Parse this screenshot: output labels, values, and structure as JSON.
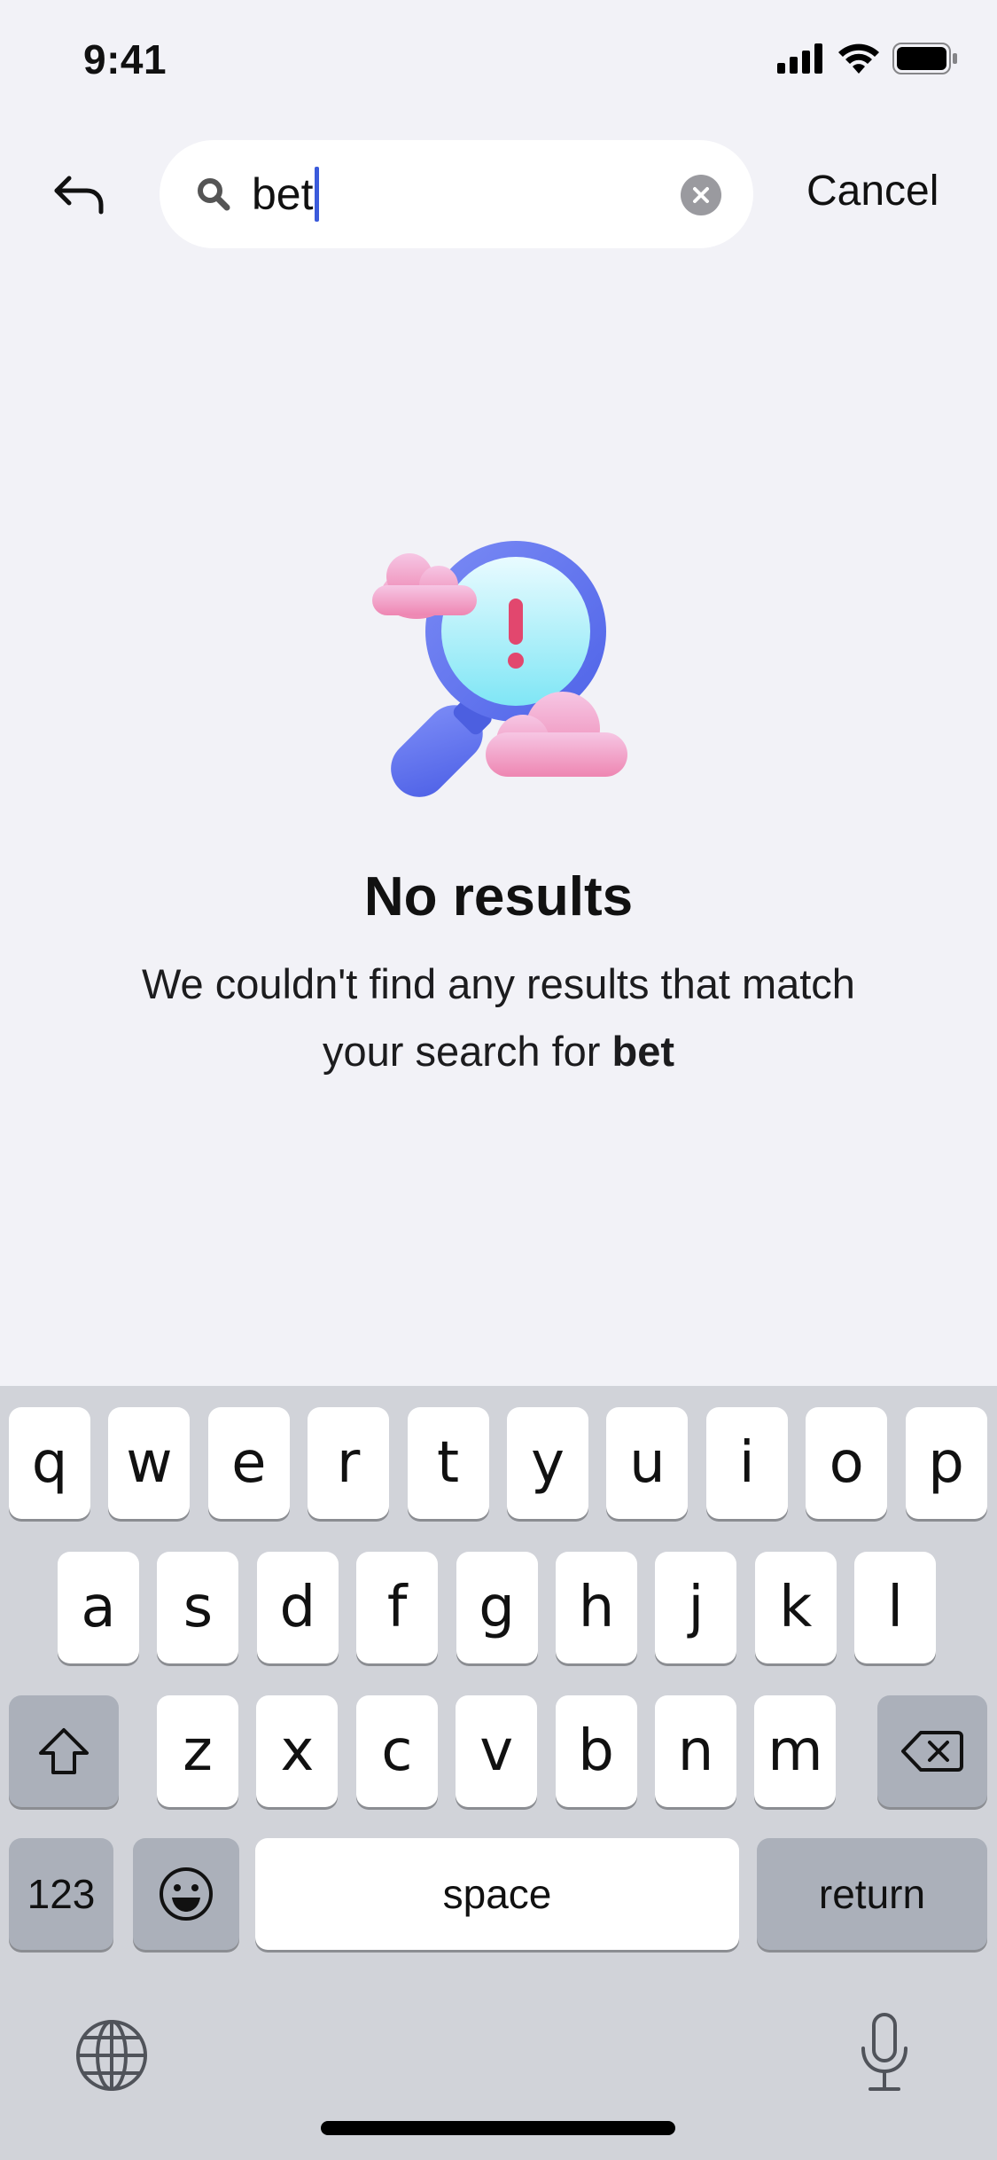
{
  "status_bar": {
    "time": "9:41"
  },
  "search": {
    "query": "bet",
    "cancel_label": "Cancel"
  },
  "empty_state": {
    "title": "No results",
    "description_prefix": "We couldn't find any results that match your search for",
    "query_highlight": "bet"
  },
  "keyboard": {
    "row1": [
      "q",
      "w",
      "e",
      "r",
      "t",
      "y",
      "u",
      "i",
      "o",
      "p"
    ],
    "row2": [
      "a",
      "s",
      "d",
      "f",
      "g",
      "h",
      "j",
      "k",
      "l"
    ],
    "row3": [
      "z",
      "x",
      "c",
      "v",
      "b",
      "n",
      "m"
    ],
    "numbers_label": "123",
    "space_label": "space",
    "return_label": "return"
  },
  "colors": {
    "background": "#F2F2F7",
    "accent": "#3B5BDB",
    "keyboard_bg": "#D1D3D9"
  }
}
